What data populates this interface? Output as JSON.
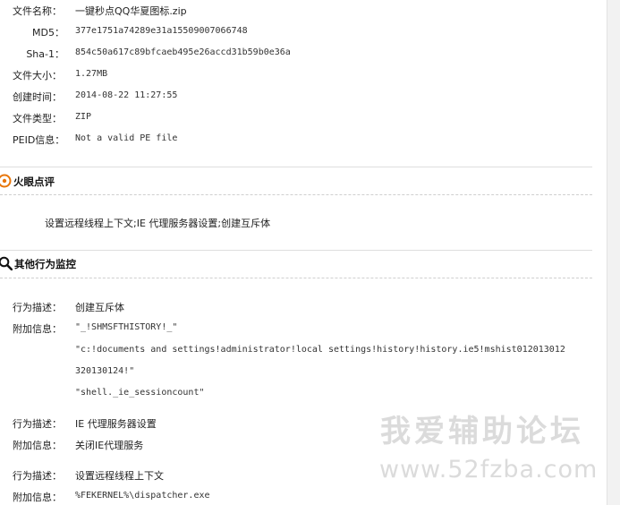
{
  "file_info": {
    "name_label": "文件名称：",
    "name_value": "一键秒点QQ华夏图标.zip",
    "md5_label": "MD5：",
    "md5_value": "377e1751a74289e31a15509007066748",
    "sha1_label": "Sha-1：",
    "sha1_value": "854c50a617c89bfcaeb495e26accd31b59b0e36a",
    "size_label": "文件大小：",
    "size_value": "1.27MB",
    "created_label": "创建时间：",
    "created_value": "2014-08-22 11:27:55",
    "type_label": "文件类型：",
    "type_value": "ZIP",
    "peid_label": "PEID信息：",
    "peid_value": "Not a valid PE file"
  },
  "review": {
    "title": "火眼点评",
    "text": "设置远程线程上下文;IE 代理服务器设置;创建互斥体"
  },
  "monitor": {
    "title": "其他行为监控",
    "entries": [
      {
        "desc_label": "行为描述：",
        "desc_value": "创建互斥体",
        "info_label": "附加信息：",
        "info_lines": [
          "\"_!SHMSFTHISTORY!_\"",
          "\"c:!documents and settings!administrator!local settings!history!history.ie5!mshist012013012",
          "320130124!\"",
          "\"shell._ie_sessioncount\""
        ]
      },
      {
        "desc_label": "行为描述：",
        "desc_value": "IE 代理服务器设置",
        "info_label": "附加信息：",
        "info_lines": [
          "关闭IE代理服务"
        ]
      },
      {
        "desc_label": "行为描述：",
        "desc_value": "设置远程线程上下文",
        "info_label": "附加信息：",
        "info_lines": [
          "%FEKERNEL%\\dispatcher.exe"
        ]
      }
    ]
  },
  "watermark": {
    "line1": "我爱辅助论坛",
    "line2": "www.52fzba.com"
  },
  "colors": {
    "fire_icon": "#e8760a",
    "text": "#222222",
    "divider": "#cfcfcf"
  }
}
